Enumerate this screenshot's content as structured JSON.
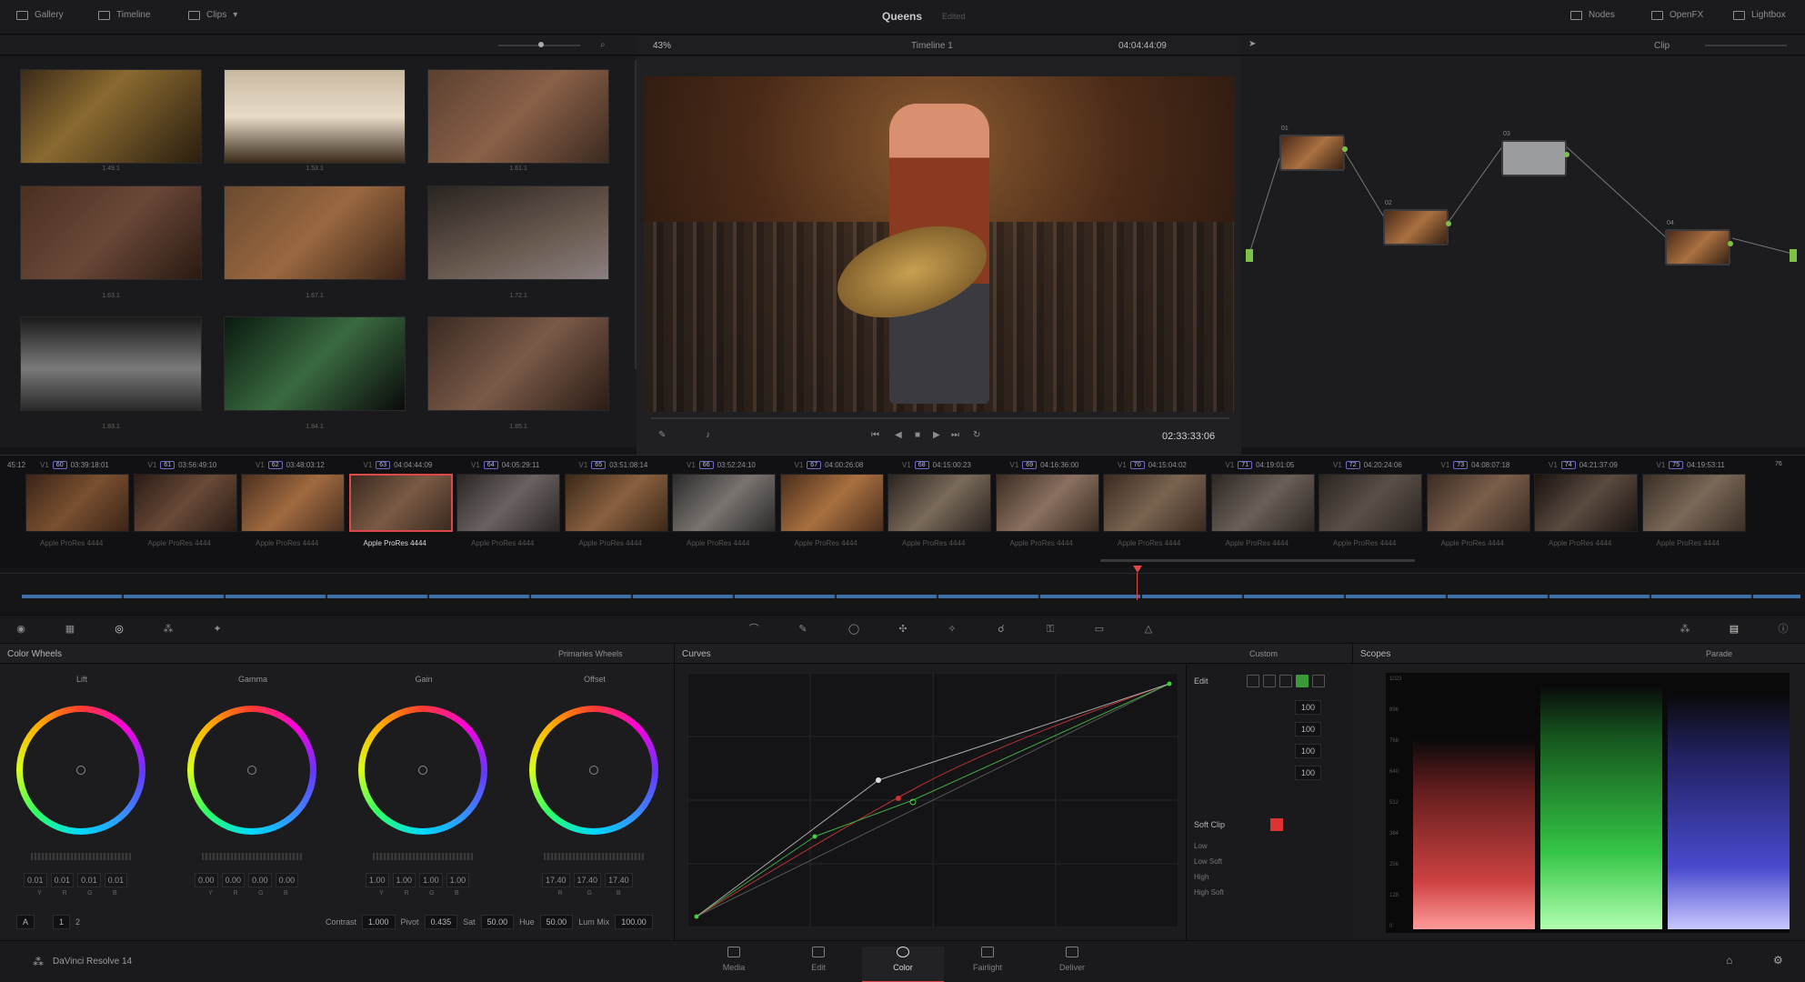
{
  "topbar": {
    "gallery": "Gallery",
    "timeline": "Timeline",
    "clips": "Clips",
    "project": "Queens",
    "project_status": "Edited",
    "nodes": "Nodes",
    "openfx": "OpenFX",
    "lightbox": "Lightbox"
  },
  "viewer_bar": {
    "zoom": "43%",
    "timeline_name": "Timeline 1",
    "timecode": "04:04:44:09",
    "clip_mode": "Clip"
  },
  "gallery": {
    "labels": [
      "1.49.1",
      "1.53.1",
      "1.61.1",
      "1.63.1",
      "1.67.1",
      "1.72.1",
      "1.83.1",
      "1.84.1",
      "1.85.1"
    ]
  },
  "viewer": {
    "timecode": "02:33:33:06"
  },
  "nodes": {
    "labels": [
      "01",
      "02",
      "03",
      "04"
    ]
  },
  "strip": {
    "left_tc": "45:12",
    "clips": [
      {
        "num": "60",
        "tc": "03:39:18:01",
        "track": "V1",
        "name": "Apple ProRes 4444"
      },
      {
        "num": "61",
        "tc": "03:56:49:10",
        "track": "V1",
        "name": "Apple ProRes 4444"
      },
      {
        "num": "62",
        "tc": "03:48:03:12",
        "track": "V1",
        "name": "Apple ProRes 4444"
      },
      {
        "num": "63",
        "tc": "04:04:44:09",
        "track": "V1",
        "name": "Apple ProRes 4444"
      },
      {
        "num": "64",
        "tc": "04:05:29:11",
        "track": "V1",
        "name": "Apple ProRes 4444"
      },
      {
        "num": "65",
        "tc": "03:51:08:14",
        "track": "V1",
        "name": "Apple ProRes 4444"
      },
      {
        "num": "66",
        "tc": "03:52:24:10",
        "track": "V1",
        "name": "Apple ProRes 4444"
      },
      {
        "num": "67",
        "tc": "04:00:26:08",
        "track": "V1",
        "name": "Apple ProRes 4444"
      },
      {
        "num": "68",
        "tc": "04:15:00:23",
        "track": "V1",
        "name": "Apple ProRes 4444"
      },
      {
        "num": "69",
        "tc": "04:16:36:00",
        "track": "V1",
        "name": "Apple ProRes 4444"
      },
      {
        "num": "70",
        "tc": "04:15:04:02",
        "track": "V1",
        "name": "Apple ProRes 4444"
      },
      {
        "num": "71",
        "tc": "04:19:01:05",
        "track": "V1",
        "name": "Apple ProRes 4444"
      },
      {
        "num": "72",
        "tc": "04:20:24:06",
        "track": "V1",
        "name": "Apple ProRes 4444"
      },
      {
        "num": "73",
        "tc": "04:08:07:18",
        "track": "V1",
        "name": "Apple ProRes 4444"
      },
      {
        "num": "74",
        "tc": "04:21:37:09",
        "track": "V1",
        "name": "Apple ProRes 4444"
      },
      {
        "num": "75",
        "tc": "04:19:53:11",
        "track": "V1",
        "name": "Apple ProRes 4444"
      }
    ],
    "last_num": "76"
  },
  "color_wheels": {
    "title": "Color Wheels",
    "mode": "Primaries Wheels",
    "wheels": [
      {
        "name": "Lift",
        "values": [
          "0.01",
          "0.01",
          "0.01",
          "0.01"
        ]
      },
      {
        "name": "Gamma",
        "values": [
          "0.00",
          "0.00",
          "0.00",
          "0.00"
        ]
      },
      {
        "name": "Gain",
        "values": [
          "1.00",
          "1.00",
          "1.00",
          "1.00"
        ]
      },
      {
        "name": "Offset",
        "values": [
          "17.40",
          "17.40",
          "17.40"
        ]
      }
    ],
    "channels": [
      "Y",
      "R",
      "G",
      "B"
    ],
    "offset_channels": [
      "R",
      "G",
      "B"
    ],
    "bottom": {
      "contrast_label": "Contrast",
      "contrast": "1.000",
      "pivot_label": "Pivot",
      "pivot": "0.435",
      "sat_label": "Sat",
      "sat": "50.00",
      "hue_label": "Hue",
      "hue": "50.00",
      "lummix_label": "Lum Mix",
      "lummix": "100.00"
    }
  },
  "curves": {
    "title": "Curves",
    "mode": "Custom",
    "edit_label": "Edit",
    "edit_values": [
      "100",
      "100",
      "100",
      "100"
    ],
    "softclip_label": "Soft Clip",
    "softclip_rows": [
      "Low",
      "Low Soft",
      "High",
      "High Soft"
    ]
  },
  "scopes": {
    "title": "Scopes",
    "mode": "Parade",
    "ticks": [
      "1023",
      "896",
      "768",
      "640",
      "512",
      "384",
      "256",
      "128",
      "0"
    ]
  },
  "bottombar": {
    "app": "DaVinci Resolve 14",
    "pages": [
      "Media",
      "Edit",
      "Color",
      "Fairlight",
      "Deliver"
    ],
    "active_page": "Color"
  },
  "colors": {
    "accent": "#e04848",
    "node_port": "#7dc246",
    "clip_badge": "#6a6cbf"
  }
}
